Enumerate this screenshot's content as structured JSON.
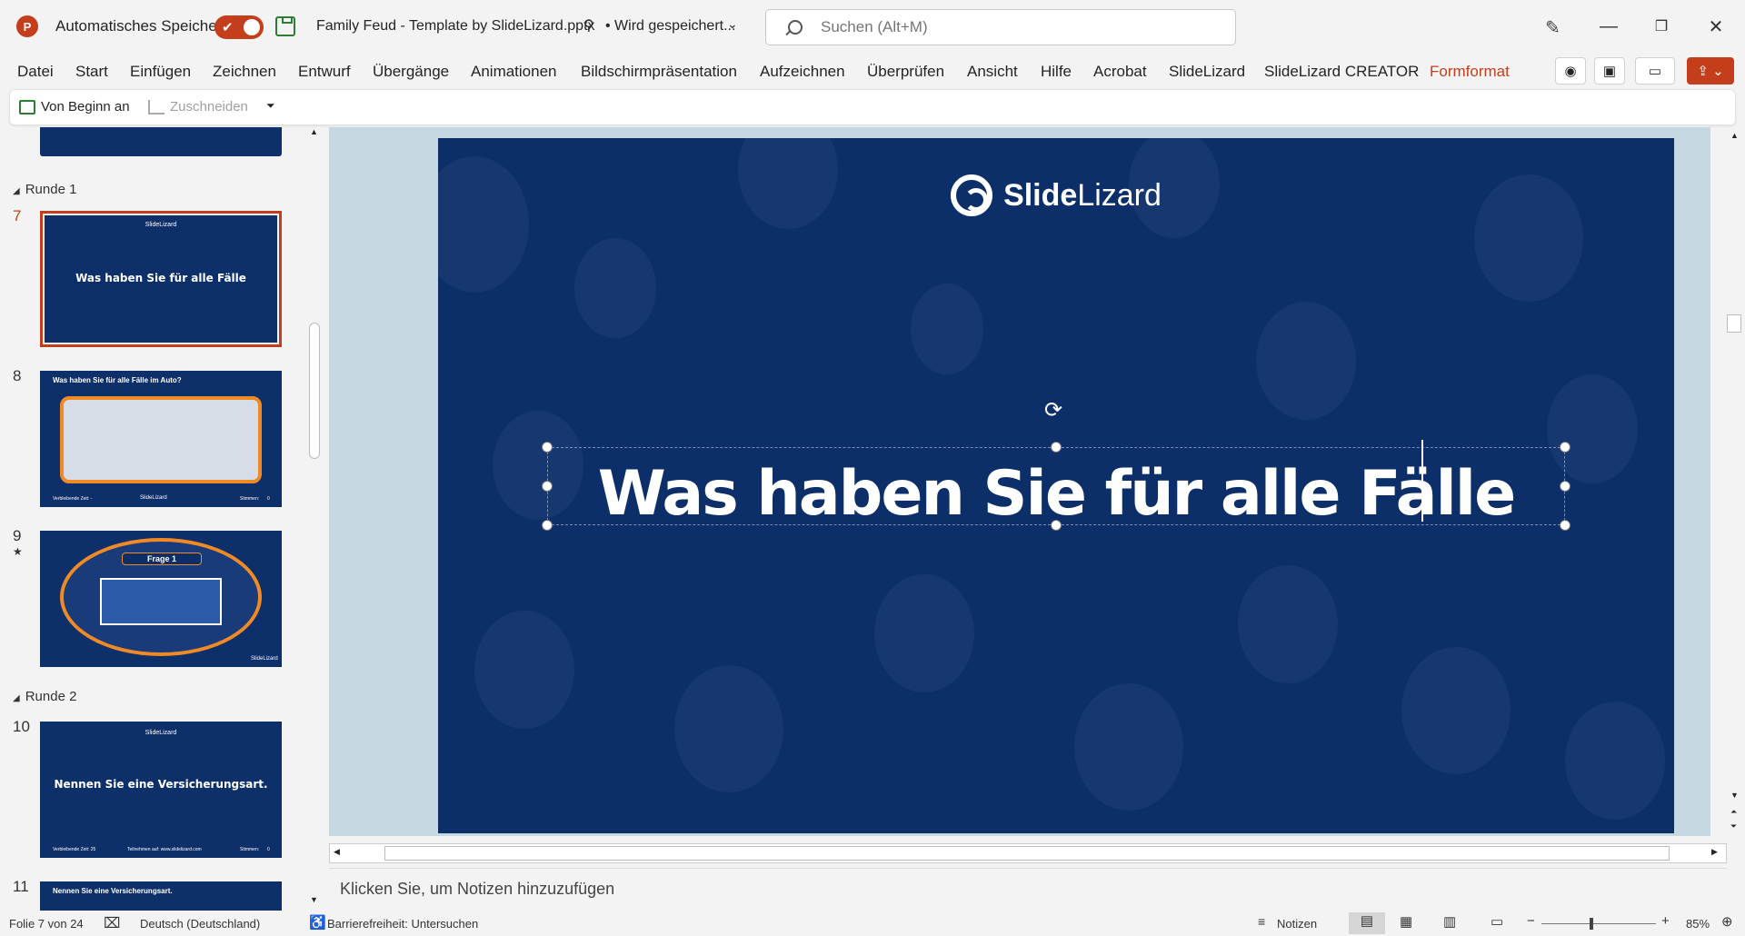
{
  "titlebar": {
    "autosave_label": "Automatisches Speichern",
    "document_title": "Family Feud - Template by SlideLizard.pptx",
    "save_status": "• Wird gespeichert...",
    "search_placeholder": "Suchen (Alt+M)"
  },
  "menu": [
    "Datei",
    "Start",
    "Einfügen",
    "Zeichnen",
    "Entwurf",
    "Übergänge",
    "Animationen",
    "Bildschirmpräsentation",
    "Aufzeichnen",
    "Überprüfen",
    "Ansicht",
    "Hilfe",
    "Acrobat",
    "SlideLizard",
    "SlideLizard CREATOR",
    "Formformat"
  ],
  "ribbon": {
    "from_start": "Von Beginn an",
    "crop": "Zuschneiden"
  },
  "thumbnails": {
    "section1": "Runde 1",
    "section2": "Runde 2",
    "slide7_num": "7",
    "slide7_logo": "SlideLizard",
    "slide7_title": "Was haben Sie für alle Fälle",
    "slide8_num": "8",
    "slide8_title": "Was haben Sie für alle Fälle im Auto?",
    "slide8_footer_left": "Verbleibende Zeit: -",
    "slide8_footer_logo": "SlideLizard",
    "slide8_footer_right": "Stimmen:",
    "slide8_footer_count": "0",
    "slide9_num": "9",
    "slide9_star": "★",
    "slide9_header": "Frage 1",
    "slide9_logo": "SlideLizard",
    "slide10_num": "10",
    "slide10_logo": "SlideLizard",
    "slide10_title": "Nennen Sie eine Versicherungsart.",
    "slide10_footer_left": "Verbleibende Zeit: 25",
    "slide10_footer_mid": "Teilnehmen auf: www.slidelizard.com",
    "slide10_footer_right": "Stimmen:",
    "slide10_footer_count": "0",
    "slide11_num": "11",
    "slide11_title": "Nennen Sie eine Versicherungsart."
  },
  "slide": {
    "logo_bold": "Slide",
    "logo_light": "Lizard",
    "title": "Was haben Sie für alle Fälle"
  },
  "notes_placeholder": "Klicken Sie, um Notizen hinzuzufügen",
  "statusbar": {
    "slide_info": "Folie 7 von 24",
    "language": "Deutsch (Deutschland)",
    "accessibility": "Barrierefreiheit: Untersuchen",
    "notes": "Notizen",
    "zoom": "85%"
  },
  "colors": {
    "accent": "#c43e1c",
    "slide_bg": "#0c2f69",
    "editor_bg": "#c6d8e1"
  }
}
